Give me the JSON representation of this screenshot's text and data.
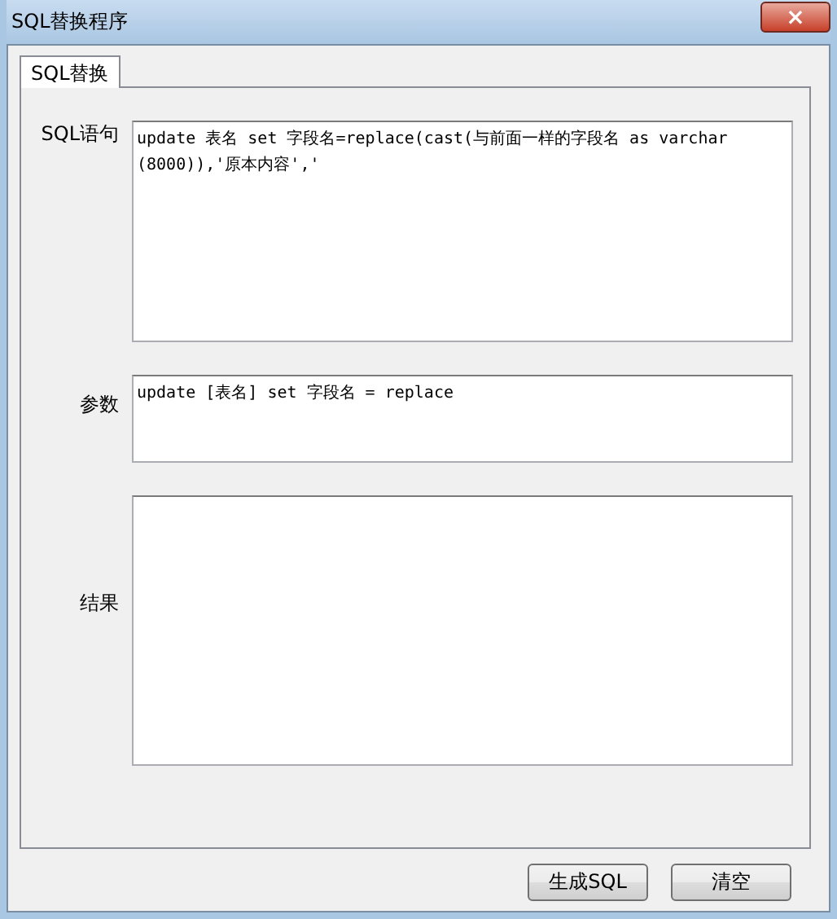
{
  "window": {
    "title": "SQL替换程序",
    "close": "×"
  },
  "tabs": [
    {
      "label": "SQL替换",
      "selected": true
    }
  ],
  "fields": [
    {
      "label": "SQL语句",
      "value": "update 表名 set 字段名=replace(cast(与前面一样的字段名 as varchar (8000)),'原本内容','"
    },
    {
      "label": "参数",
      "value": "update [表名] set 字段名 = replace"
    },
    {
      "label": "结果"
    }
  ],
  "buttons": [
    "生成SQL",
    "清空"
  ]
}
